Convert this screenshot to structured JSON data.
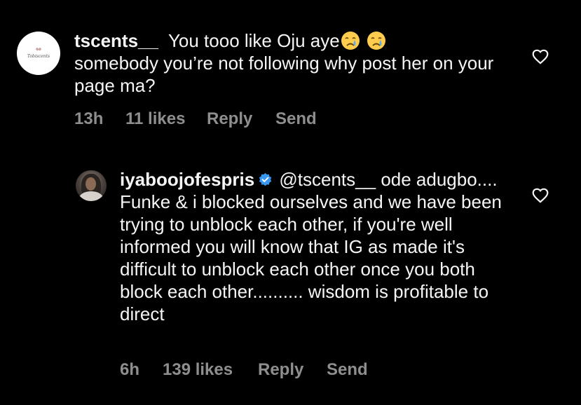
{
  "comments": [
    {
      "username": "tscents__",
      "avatar_text": "Tobiscents",
      "text_before_emoji": "You tooo like Oju aye",
      "emoji": [
        "crying-face",
        "crying-face"
      ],
      "text_after_emoji": "somebody you’re not following why post her on your page ma?",
      "time": "13h",
      "likes": "11 likes",
      "reply_label": "Reply",
      "send_label": "Send"
    },
    {
      "username": "iyaboojofespris",
      "verified": true,
      "mention": "@tscents__",
      "text": "ode adugbo.... Funke & i blocked ourselves and we have been trying to unblock each other, if you're well informed you will know that IG as made it's difficult to unblock each other once you both block each other.......... wisdom is profitable to direct",
      "time": "6h",
      "likes": "139 likes",
      "reply_label": "Reply",
      "send_label": "Send"
    }
  ],
  "colors": {
    "background": "#000000",
    "text": "#f5f5f5",
    "meta": "#8e8e8e",
    "verified": "#3897f0",
    "emoji": "#ffcc4d"
  }
}
